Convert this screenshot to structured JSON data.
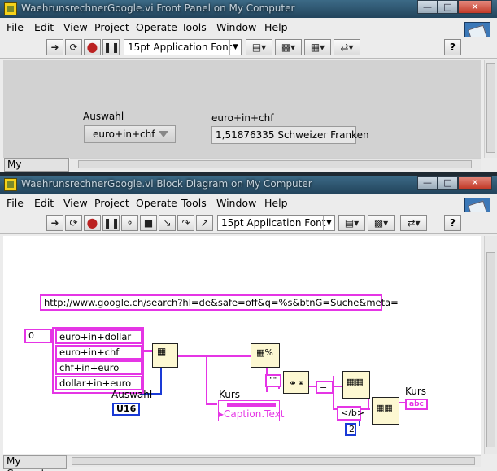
{
  "front_panel": {
    "title": "WaehrunsrechnerGoogle.vi Front Panel on My Computer",
    "menus": [
      "File",
      "Edit",
      "View",
      "Project",
      "Operate",
      "Tools",
      "Window",
      "Help"
    ],
    "font": "15pt Application Font",
    "help_label": "?",
    "controls": {
      "auswahl_label": "Auswahl",
      "auswahl_value": "euro+in+chf",
      "indicator_label": "euro+in+chf",
      "indicator_value": "1,51876335 Schweizer Franken"
    },
    "context": "My Computer"
  },
  "block_diagram": {
    "title": "WaehrunsrechnerGoogle.vi Block Diagram on My Computer",
    "menus": [
      "File",
      "Edit",
      "View",
      "Project",
      "Operate",
      "Tools",
      "Window",
      "Help"
    ],
    "font": "15pt Application Font",
    "help_label": "?",
    "url_constant": "http://www.google.ch/search?hl=de&safe=off&q=%s&btnG=Suche&meta=",
    "array_index": "0",
    "array_items": [
      "euro+in+dollar",
      "euro+in+chf",
      "chf+in+euro",
      "dollar+in+euro"
    ],
    "auswahl_label": "Auswahl",
    "auswahl_terminal": "U16",
    "kurs_label": "Kurs",
    "caption_property": "Caption.Text",
    "quote_constant": "\"\"",
    "equals_constant": "=",
    "bold_end_constant": "</b>",
    "number_constant": "2",
    "kurs_output_label": "Kurs",
    "kurs_output_terminal": "abc",
    "context": "My Computer"
  },
  "colors": {
    "string_wire": "#e535e5",
    "numeric_wire": "#1a3ad6",
    "titlebar": "#2c536e",
    "close_button": "#c8402e"
  },
  "icons": {
    "run": "run-arrow-icon",
    "run_continuously": "run-continuously-icon",
    "abort": "abort-icon",
    "pause": "pause-icon",
    "highlight": "lightbulb-icon",
    "close": "close-icon"
  }
}
